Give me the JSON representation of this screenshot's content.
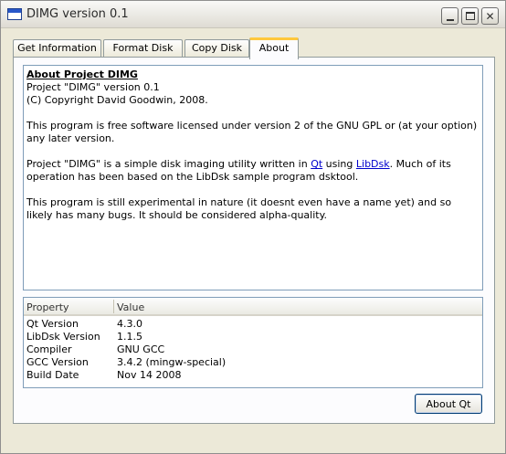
{
  "window": {
    "title": "DIMG version 0.1"
  },
  "tabs": [
    {
      "label": "Get Information",
      "active": false
    },
    {
      "label": "Format Disk",
      "active": false
    },
    {
      "label": "Copy Disk",
      "active": false
    },
    {
      "label": "About",
      "active": true
    }
  ],
  "about": {
    "heading": "About Project DIMG",
    "version_line": "Project \"DIMG\" version 0.1",
    "copyright_line": "(C) Copyright David Goodwin, 2008.",
    "license_text": "This program is free software licensed under version 2 of the GNU GPL or (at your option) any later version.",
    "desc_prefix": "Project \"DIMG\" is a simple disk imaging utility written in ",
    "link_qt": "Qt",
    "desc_mid": " using ",
    "link_libdsk": "LibDsk",
    "desc_suffix": ". Much of its operation has been based on the LibDsk sample program dsktool.",
    "experimental_text": "This program is still experimental in nature (it doesnt even have a name yet) and so likely has many bugs. It should be considered alpha-quality."
  },
  "table": {
    "columns": [
      "Property",
      "Value"
    ],
    "rows": [
      [
        "Qt Version",
        "4.3.0"
      ],
      [
        "LibDsk Version",
        "1.1.5"
      ],
      [
        "Compiler",
        "GNU GCC"
      ],
      [
        "GCC Version",
        "3.4.2 (mingw-special)"
      ],
      [
        "Build Date",
        "Nov 14 2008"
      ]
    ]
  },
  "buttons": {
    "about_qt": "About Qt"
  },
  "icons": {
    "app": "window-app-icon",
    "minimize": "minimize-icon",
    "maximize": "maximize-icon",
    "close": "close-icon"
  }
}
